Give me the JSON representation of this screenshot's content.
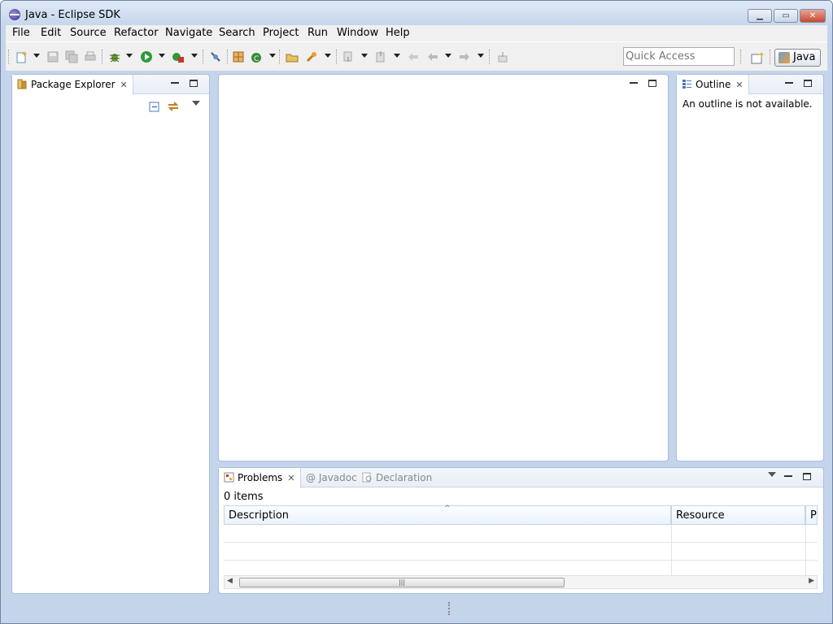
{
  "window": {
    "title": "Java - Eclipse SDK"
  },
  "menu": [
    {
      "label": "File"
    },
    {
      "label": "Edit"
    },
    {
      "label": "Source"
    },
    {
      "label": "Refactor"
    },
    {
      "label": "Navigate"
    },
    {
      "label": "Search"
    },
    {
      "label": "Project"
    },
    {
      "label": "Run"
    },
    {
      "label": "Window"
    },
    {
      "label": "Help"
    }
  ],
  "toolbar": {
    "quick_access_placeholder": "Quick Access",
    "perspective_label": "Java"
  },
  "package_explorer": {
    "tab_label": "Package Explorer"
  },
  "outline": {
    "tab_label": "Outline",
    "message": "An outline is not available."
  },
  "bottom_panel": {
    "tabs": [
      {
        "label": "Problems"
      },
      {
        "label": "@ Javadoc"
      },
      {
        "label": "Declaration"
      }
    ],
    "item_count": "0 items",
    "columns": [
      "Description",
      "Resource",
      "Pa"
    ]
  },
  "colors": {
    "window_frame": "#c4d4ea",
    "panel_border": "#a9bedb",
    "close_button": "#c74a32"
  }
}
